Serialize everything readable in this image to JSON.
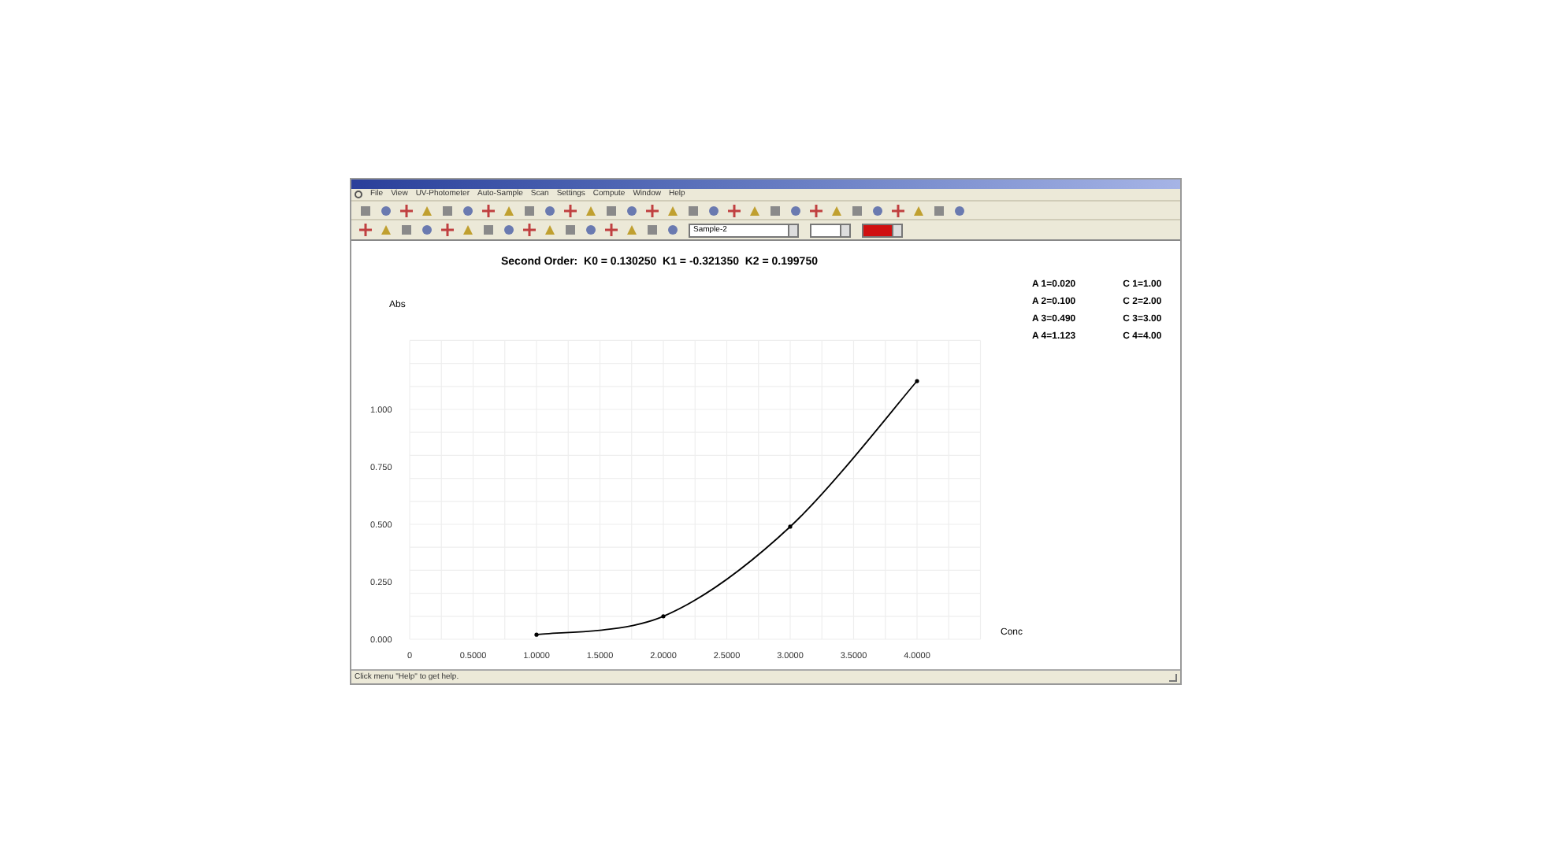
{
  "menu": [
    {
      "label": "File"
    },
    {
      "label": "View"
    },
    {
      "label": "UV-Photometer"
    },
    {
      "label": "Auto-Sample"
    },
    {
      "label": "Scan"
    },
    {
      "label": "Settings"
    },
    {
      "label": "Compute"
    },
    {
      "label": "Window"
    },
    {
      "label": "Help"
    }
  ],
  "toolbar": {
    "sample_select": "Sample-2",
    "color_select": {
      "color": "#d01010"
    }
  },
  "chart": {
    "title": "Second Order:  K0 = 0.130250  K1 = -0.321350  K2 = 0.199750",
    "chart_data": {
      "type": "line",
      "xlabel": "Conc",
      "ylabel": "Abs",
      "x": [
        1,
        2,
        3,
        4
      ],
      "grid": true,
      "series": [
        {
          "color": "#000000",
          "values": [
            0.02,
            0.1,
            0.49,
            1.123
          ]
        }
      ],
      "xlim": [
        0,
        4.5
      ],
      "ylim": [
        0,
        1.3
      ],
      "xticks": [
        {
          "value": 0,
          "label": "0"
        },
        {
          "value": 0.5,
          "label": "0.5000"
        },
        {
          "value": 1,
          "label": "1.0000"
        },
        {
          "value": 1.5,
          "label": "1.5000"
        },
        {
          "value": 2,
          "label": "2.0000"
        },
        {
          "value": 2.5,
          "label": "2.5000"
        },
        {
          "value": 3,
          "label": "3.0000"
        },
        {
          "value": 3.5,
          "label": "3.5000"
        },
        {
          "value": 4,
          "label": "4.0000"
        }
      ],
      "yticks": [
        {
          "value": 0,
          "label": "0.000"
        },
        {
          "value": 0.25,
          "label": "0.250"
        },
        {
          "value": 0.5,
          "label": "0.500"
        },
        {
          "value": 0.75,
          "label": "0.750"
        },
        {
          "value": 1,
          "label": "1.000"
        }
      ]
    },
    "legend": [
      {
        "a": "A 1=0.020",
        "c": "C 1=1.00"
      },
      {
        "a": "A 2=0.100",
        "c": "C 2=2.00"
      },
      {
        "a": "A 3=0.490",
        "c": "C 3=3.00"
      },
      {
        "a": "A 4=1.123",
        "c": "C 4=4.00"
      }
    ]
  },
  "status_bar": "Click menu \"Help\" to get help."
}
